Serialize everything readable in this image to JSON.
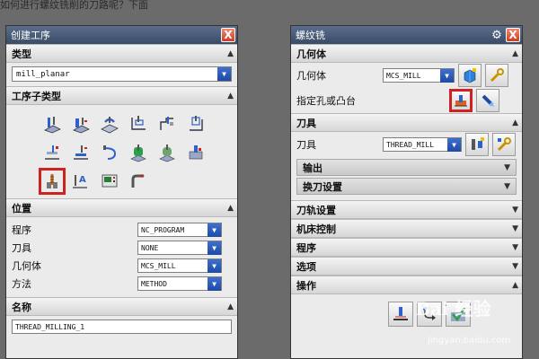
{
  "caption": "如何进行螺纹铣削的刀路呢？下面",
  "left_dialog": {
    "title": "创建工序",
    "close": "X",
    "type": {
      "header": "类型",
      "value": "mill_planar"
    },
    "subtype": {
      "header": "工序子类型"
    },
    "location": {
      "header": "位置",
      "rows": [
        {
          "label": "程序",
          "value": "NC_PROGRAM"
        },
        {
          "label": "刀具",
          "value": "NONE"
        },
        {
          "label": "几何体",
          "value": "MCS_MILL"
        },
        {
          "label": "方法",
          "value": "METHOD"
        }
      ]
    },
    "name": {
      "header": "名称",
      "value": "THREAD_MILLING_1"
    }
  },
  "right_dialog": {
    "title": "螺纹铣",
    "close": "X",
    "geometry": {
      "header": "几何体",
      "label": "几何体",
      "value": "MCS_MILL",
      "specify_label": "指定孔或凸台"
    },
    "tool": {
      "header": "刀具",
      "label": "刀具",
      "value": "THREAD_MILL",
      "output": "输出",
      "tool_change": "换刀设置"
    },
    "path_settings": "刀轨设置",
    "machine_control": "机床控制",
    "program": "程序",
    "options": "选项",
    "actions": "操作"
  },
  "watermark": {
    "brand": "Bai 经验",
    "url": "jingyan.baidu.com"
  },
  "colors": {
    "title_bar": "#3a4b66",
    "selected_outline": "#d02020",
    "dropdown": "#1f4aa3"
  }
}
